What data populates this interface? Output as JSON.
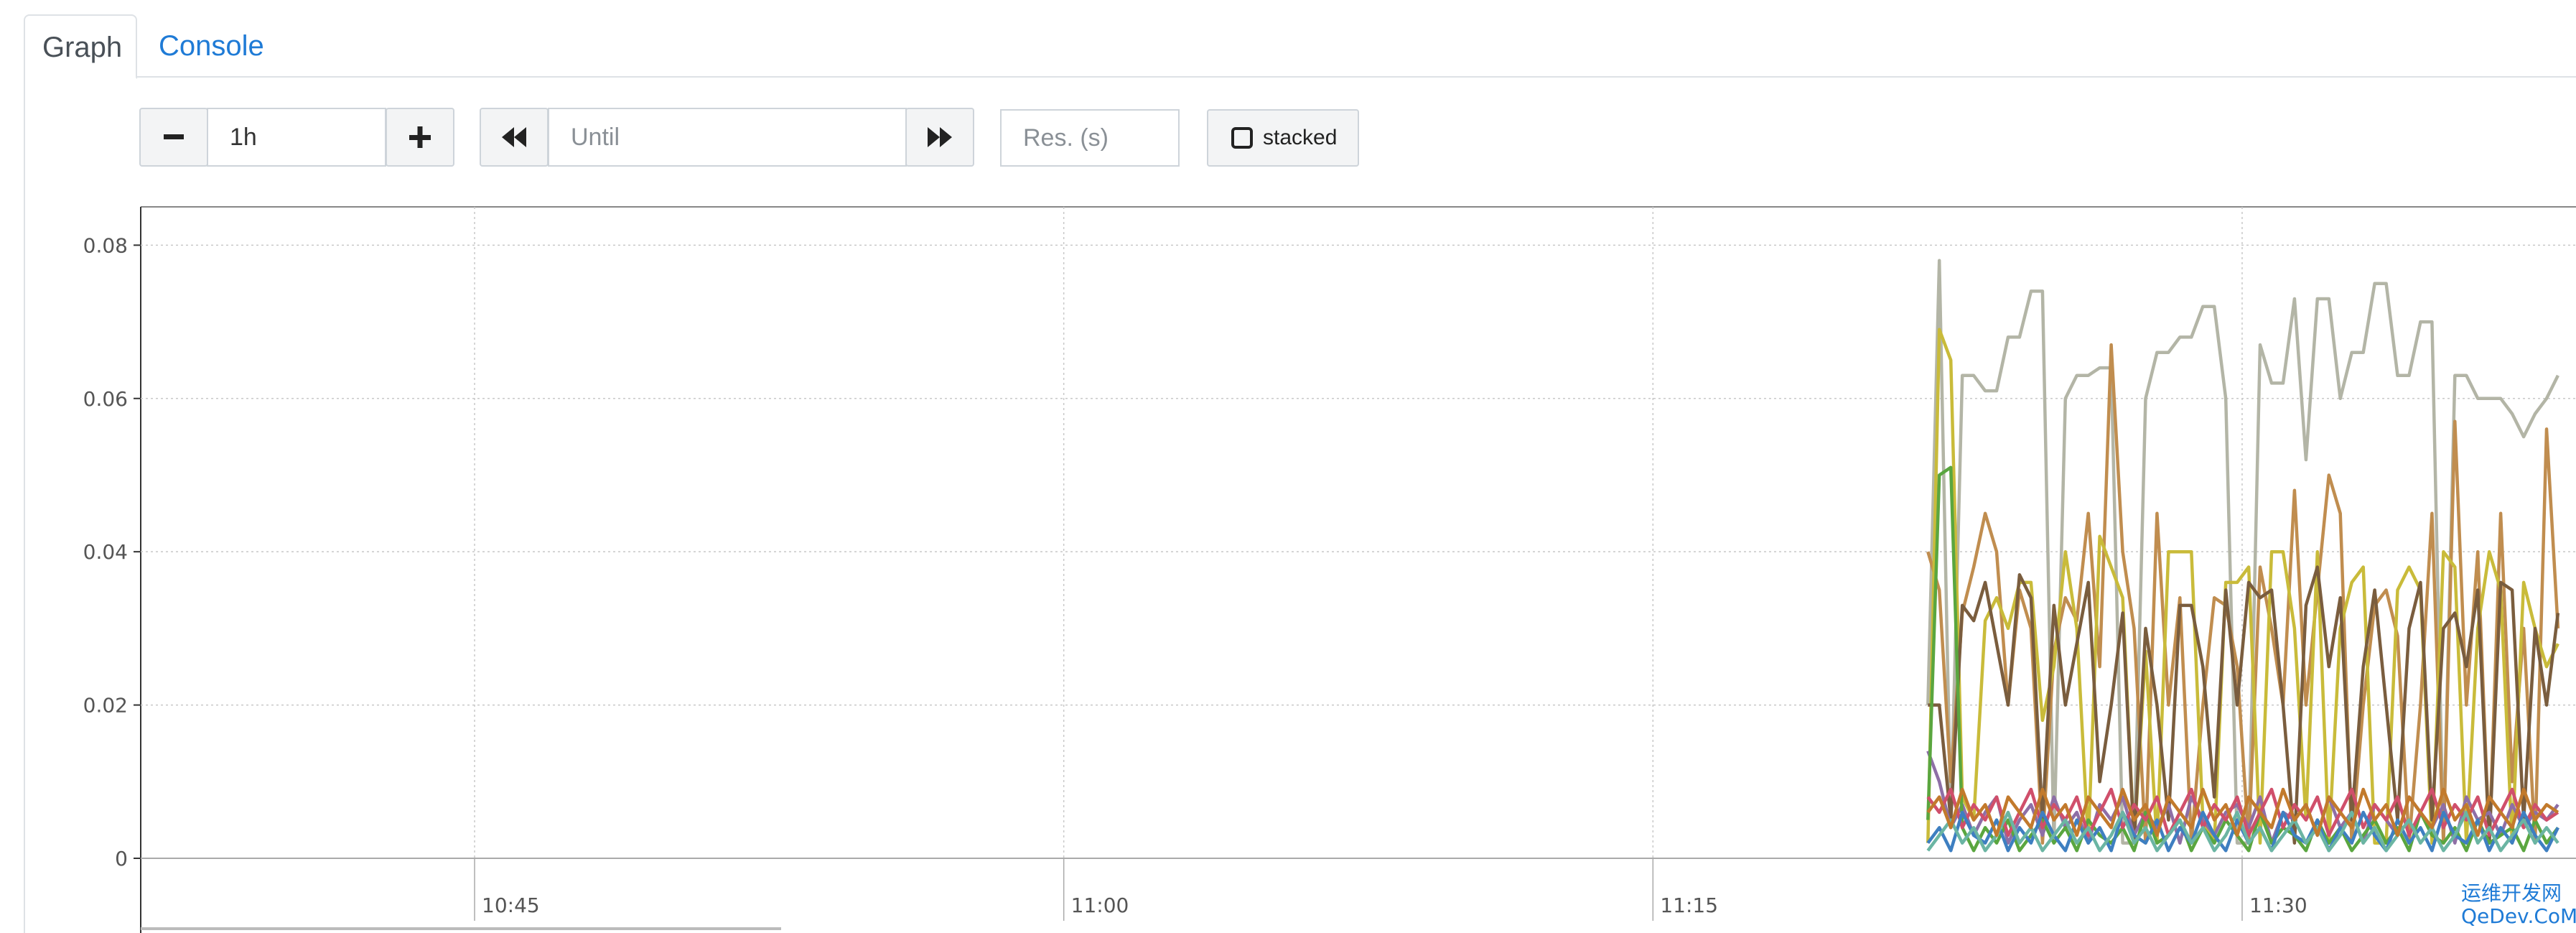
{
  "tabs": [
    {
      "label": "Graph",
      "active": true
    },
    {
      "label": "Console",
      "active": false
    }
  ],
  "toolbar": {
    "zoom_out_label": "−",
    "range_value": "1h",
    "zoom_in_label": "+",
    "until_placeholder": "Until",
    "resolution_placeholder": "Res. (s)",
    "stacked_label": "stacked",
    "stacked_checked": false
  },
  "chart_data": {
    "type": "line",
    "ylim": [
      0,
      0.085
    ],
    "y_ticks": [
      "0.08",
      "0.06",
      "0.04",
      "0.02",
      "0"
    ],
    "y_tick_values": [
      0.08,
      0.06,
      0.04,
      0.02,
      0
    ],
    "x_ticks": [
      "10:45",
      "11:00",
      "11:15",
      "11:30"
    ],
    "x_range": [
      "10:36:30",
      "11:38:30"
    ],
    "grid": true,
    "series_colors": [
      "#b3b5a6",
      "#c08d4f",
      "#c9bb3a",
      "#7a5d3e",
      "#8e6fa6",
      "#5aa63f",
      "#d04f6b",
      "#3e7fc1",
      "#6bb5a3",
      "#c27a2c"
    ],
    "series": [
      {
        "x_start": "11:22",
        "x_step_sec": 17.5,
        "values": [
          0.02,
          0.078,
          0.005,
          0.063,
          0.063,
          0.061,
          0.061,
          0.068,
          0.068,
          0.074,
          0.074,
          0.002,
          0.06,
          0.063,
          0.063,
          0.064,
          0.064,
          0.002,
          0.002,
          0.06,
          0.066,
          0.066,
          0.068,
          0.068,
          0.072,
          0.072,
          0.06,
          0.002,
          0.002,
          0.067,
          0.062,
          0.062,
          0.073,
          0.052,
          0.073,
          0.073,
          0.06,
          0.066,
          0.066,
          0.075,
          0.075,
          0.063,
          0.063,
          0.07,
          0.07,
          0.002,
          0.063,
          0.063,
          0.06,
          0.06,
          0.06,
          0.058,
          0.055,
          0.058,
          0.06,
          0.063
        ]
      },
      {
        "x_start": "11:22",
        "x_step_sec": 17.5,
        "values": [
          0.04,
          0.035,
          0.01,
          0.032,
          0.038,
          0.045,
          0.04,
          0.02,
          0.035,
          0.03,
          0.002,
          0.027,
          0.034,
          0.031,
          0.045,
          0.025,
          0.067,
          0.04,
          0.03,
          0.002,
          0.045,
          0.02,
          0.034,
          0.002,
          0.02,
          0.034,
          0.033,
          0.025,
          0.002,
          0.038,
          0.03,
          0.02,
          0.048,
          0.02,
          0.035,
          0.05,
          0.045,
          0.002,
          0.02,
          0.033,
          0.035,
          0.029,
          0.002,
          0.02,
          0.045,
          0.002,
          0.057,
          0.02,
          0.04,
          0.002,
          0.045,
          0.01,
          0.03,
          0.002,
          0.056,
          0.03
        ]
      },
      {
        "x_start": "11:22",
        "x_step_sec": 17.5,
        "values": [
          0.002,
          0.069,
          0.065,
          0.008,
          0.005,
          0.031,
          0.034,
          0.03,
          0.036,
          0.036,
          0.018,
          0.025,
          0.04,
          0.03,
          0.002,
          0.042,
          0.038,
          0.034,
          0.002,
          0.027,
          0.002,
          0.04,
          0.04,
          0.04,
          0.005,
          0.002,
          0.036,
          0.036,
          0.038,
          0.002,
          0.04,
          0.04,
          0.03,
          0.005,
          0.04,
          0.002,
          0.03,
          0.036,
          0.038,
          0.002,
          0.002,
          0.035,
          0.038,
          0.035,
          0.002,
          0.04,
          0.038,
          0.002,
          0.03,
          0.04,
          0.035,
          0.002,
          0.036,
          0.03,
          0.025,
          0.028
        ]
      },
      {
        "x_start": "11:22",
        "x_step_sec": 17.5,
        "values": [
          0.02,
          0.02,
          0.005,
          0.033,
          0.031,
          0.036,
          0.028,
          0.02,
          0.037,
          0.034,
          0.005,
          0.033,
          0.02,
          0.028,
          0.036,
          0.01,
          0.02,
          0.032,
          0.002,
          0.03,
          0.02,
          0.005,
          0.033,
          0.033,
          0.025,
          0.008,
          0.035,
          0.02,
          0.036,
          0.034,
          0.035,
          0.02,
          0.002,
          0.033,
          0.038,
          0.025,
          0.034,
          0.005,
          0.025,
          0.035,
          0.02,
          0.005,
          0.03,
          0.036,
          0.005,
          0.03,
          0.032,
          0.025,
          0.035,
          0.002,
          0.036,
          0.035,
          0.005,
          0.03,
          0.02,
          0.032
        ]
      },
      {
        "x_start": "11:22",
        "x_step_sec": 17.5,
        "values": [
          0.014,
          0.01,
          0.004,
          0.007,
          0.003,
          0.006,
          0.008,
          0.002,
          0.005,
          0.007,
          0.003,
          0.008,
          0.004,
          0.006,
          0.002,
          0.007,
          0.005,
          0.008,
          0.003,
          0.006,
          0.004,
          0.007,
          0.002,
          0.008,
          0.005,
          0.003,
          0.006,
          0.007,
          0.004,
          0.008,
          0.002,
          0.006,
          0.005,
          0.007,
          0.003,
          0.008,
          0.004,
          0.006,
          0.002,
          0.007,
          0.005,
          0.003,
          0.008,
          0.006,
          0.004,
          0.007,
          0.002,
          0.008,
          0.005,
          0.006,
          0.003,
          0.007,
          0.004,
          0.006,
          0.005,
          0.007
        ]
      },
      {
        "x_start": "11:22",
        "x_step_sec": 17.5,
        "values": [
          0.005,
          0.05,
          0.051,
          0.004,
          0.001,
          0.004,
          0.002,
          0.005,
          0.001,
          0.003,
          0.005,
          0.002,
          0.004,
          0.001,
          0.005,
          0.003,
          0.002,
          0.004,
          0.001,
          0.006,
          0.002,
          0.003,
          0.005,
          0.001,
          0.004,
          0.002,
          0.005,
          0.003,
          0.001,
          0.006,
          0.002,
          0.004,
          0.003,
          0.001,
          0.005,
          0.002,
          0.004,
          0.001,
          0.003,
          0.005,
          0.002,
          0.004,
          0.001,
          0.006,
          0.003,
          0.002,
          0.004,
          0.001,
          0.005,
          0.002,
          0.003,
          0.004,
          0.001,
          0.005,
          0.002,
          0.004
        ]
      },
      {
        "x_start": "11:22",
        "x_step_sec": 17.5,
        "values": [
          0.008,
          0.006,
          0.009,
          0.004,
          0.007,
          0.005,
          0.008,
          0.003,
          0.006,
          0.009,
          0.004,
          0.007,
          0.005,
          0.008,
          0.003,
          0.006,
          0.009,
          0.004,
          0.007,
          0.005,
          0.008,
          0.003,
          0.006,
          0.009,
          0.004,
          0.007,
          0.005,
          0.008,
          0.003,
          0.006,
          0.009,
          0.004,
          0.007,
          0.005,
          0.008,
          0.003,
          0.006,
          0.009,
          0.004,
          0.007,
          0.005,
          0.008,
          0.003,
          0.006,
          0.009,
          0.004,
          0.007,
          0.005,
          0.008,
          0.003,
          0.006,
          0.009,
          0.004,
          0.007,
          0.005,
          0.006
        ]
      },
      {
        "x_start": "11:22",
        "x_step_sec": 17.5,
        "values": [
          0.002,
          0.004,
          0.001,
          0.006,
          0.003,
          0.002,
          0.005,
          0.001,
          0.004,
          0.002,
          0.006,
          0.003,
          0.001,
          0.005,
          0.002,
          0.004,
          0.001,
          0.006,
          0.003,
          0.002,
          0.005,
          0.001,
          0.004,
          0.002,
          0.006,
          0.003,
          0.001,
          0.005,
          0.002,
          0.004,
          0.001,
          0.006,
          0.003,
          0.002,
          0.005,
          0.001,
          0.004,
          0.002,
          0.006,
          0.003,
          0.001,
          0.005,
          0.002,
          0.004,
          0.001,
          0.006,
          0.003,
          0.002,
          0.005,
          0.001,
          0.004,
          0.002,
          0.006,
          0.003,
          0.001,
          0.004
        ]
      },
      {
        "x_start": "11:22",
        "x_step_sec": 17.5,
        "values": [
          0.001,
          0.003,
          0.005,
          0.002,
          0.004,
          0.001,
          0.003,
          0.006,
          0.002,
          0.004,
          0.001,
          0.003,
          0.005,
          0.002,
          0.004,
          0.001,
          0.003,
          0.006,
          0.002,
          0.004,
          0.001,
          0.003,
          0.005,
          0.002,
          0.004,
          0.001,
          0.003,
          0.006,
          0.002,
          0.004,
          0.001,
          0.003,
          0.005,
          0.002,
          0.004,
          0.001,
          0.003,
          0.006,
          0.002,
          0.004,
          0.001,
          0.003,
          0.005,
          0.002,
          0.004,
          0.001,
          0.003,
          0.006,
          0.002,
          0.004,
          0.001,
          0.003,
          0.005,
          0.002,
          0.004,
          0.002
        ]
      },
      {
        "x_start": "11:22",
        "x_step_sec": 17.5,
        "values": [
          0.006,
          0.008,
          0.004,
          0.009,
          0.005,
          0.007,
          0.003,
          0.008,
          0.006,
          0.004,
          0.009,
          0.005,
          0.007,
          0.003,
          0.008,
          0.006,
          0.004,
          0.009,
          0.005,
          0.007,
          0.003,
          0.008,
          0.006,
          0.004,
          0.009,
          0.005,
          0.007,
          0.003,
          0.008,
          0.006,
          0.004,
          0.009,
          0.005,
          0.007,
          0.003,
          0.008,
          0.006,
          0.004,
          0.009,
          0.005,
          0.007,
          0.003,
          0.008,
          0.006,
          0.004,
          0.009,
          0.005,
          0.007,
          0.003,
          0.008,
          0.006,
          0.004,
          0.009,
          0.005,
          0.007,
          0.006
        ]
      }
    ]
  },
  "watermark": {
    "line1": "运维开发网",
    "line2": "QeDev.CoM"
  }
}
